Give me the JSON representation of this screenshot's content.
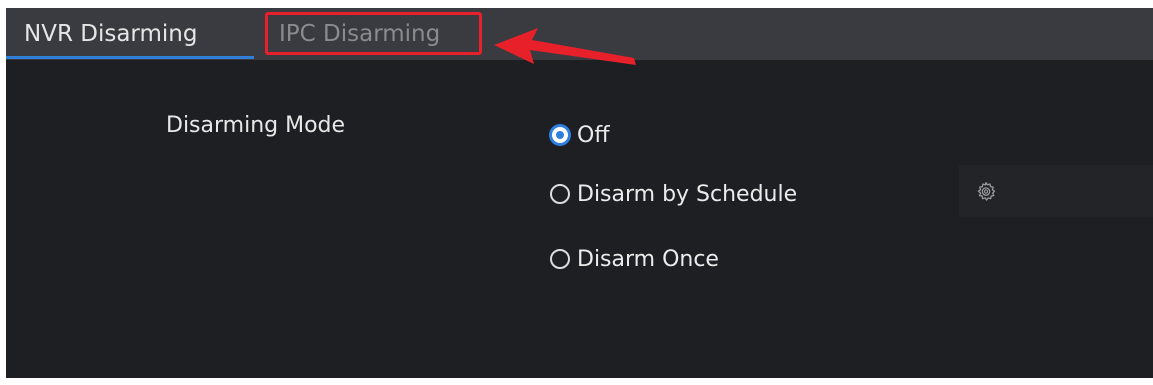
{
  "tabs": [
    {
      "label": "NVR Disarming",
      "active": true
    },
    {
      "label": "IPC Disarming",
      "active": false
    }
  ],
  "form": {
    "disarming_mode_label": "Disarming Mode",
    "options": [
      {
        "label": "Off",
        "selected": true
      },
      {
        "label": "Disarm by Schedule",
        "selected": false
      },
      {
        "label": "Disarm Once",
        "selected": false
      }
    ],
    "schedule_settings_icon": "gear-icon"
  },
  "annotation": {
    "highlight_color": "#e8202a",
    "arrow_icon": "arrow-left-icon"
  },
  "colors": {
    "background": "#1e1f22",
    "tabbar": "#3a3b40",
    "accent": "#2d7fe0"
  }
}
